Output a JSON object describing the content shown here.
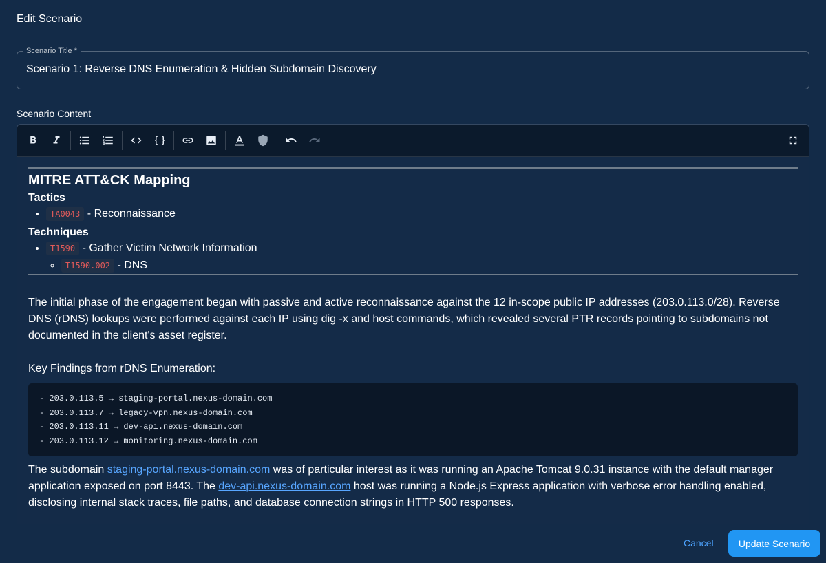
{
  "dialog": {
    "title": "Edit Scenario",
    "title_field_label": "Scenario Title *",
    "title_field_value": "Scenario 1: Reverse DNS Enumeration & Hidden Subdomain Discovery",
    "content_label": "Scenario Content"
  },
  "toolbar": {
    "icons": [
      "bold-icon",
      "italic-icon",
      "bullet-list-icon",
      "numbered-list-icon",
      "inline-code-icon",
      "code-block-icon",
      "link-icon",
      "image-icon",
      "text-color-icon",
      "highlight-icon",
      "undo-icon",
      "redo-icon",
      "fullscreen-icon"
    ]
  },
  "content": {
    "mitre_heading": "MITRE ATT&CK Mapping",
    "tactics_heading": "Tactics",
    "tactics": [
      {
        "code": "TA0043",
        "text": " - Reconnaissance"
      }
    ],
    "techniques_heading": "Techniques",
    "technique": {
      "code": "T1590",
      "text": " - Gather Victim Network Information"
    },
    "subtechnique": {
      "code": "T1590.002",
      "text": " - DNS"
    },
    "para1": "The initial phase of the engagement began with passive and active reconnaissance against the 12 in-scope public IP addresses (203.0.113.0/28). Reverse DNS (rDNS) lookups were performed against each IP using dig -x and host commands, which revealed several PTR records pointing to subdomains not documented in the client's asset register.",
    "findings_heading": "Key Findings from rDNS Enumeration:",
    "code_lines": [
      "- 203.0.113.5 → staging-portal.nexus-domain.com",
      "- 203.0.113.7 → legacy-vpn.nexus-domain.com",
      "- 203.0.113.11 → dev-api.nexus-domain.com",
      "- 203.0.113.12 → monitoring.nexus-domain.com"
    ],
    "para2": {
      "t1": "The subdomain ",
      "link1": "staging-portal.nexus-domain.com",
      "t2": " was of particular interest as it was running an Apache Tomcat 9.0.31 instance with the default manager application exposed on port 8443. The ",
      "link2": "dev-api.nexus-domain.com",
      "t3": " host was running a Node.js Express application with verbose error handling enabled, disclosing internal stack traces, file paths, and database connection strings in HTTP 500 responses."
    }
  },
  "footer": {
    "cancel_label": "Cancel",
    "update_label": "Update Scenario"
  }
}
